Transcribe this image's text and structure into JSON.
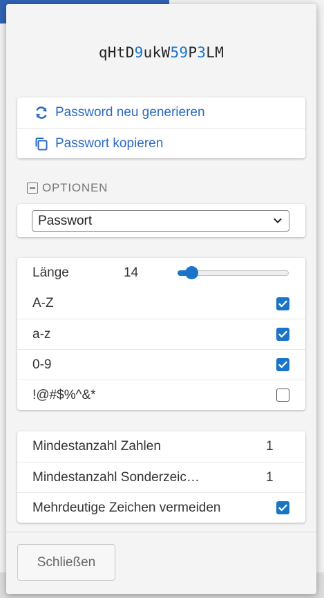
{
  "password": {
    "segments": [
      {
        "text": "qHtD",
        "digit": false
      },
      {
        "text": "9",
        "digit": true
      },
      {
        "text": "ukW",
        "digit": false
      },
      {
        "text": "59",
        "digit": true
      },
      {
        "text": "P",
        "digit": false
      },
      {
        "text": "3",
        "digit": true
      },
      {
        "text": "LM",
        "digit": false
      }
    ]
  },
  "actions": {
    "regenerate_label": "Password neu generieren",
    "regenerate_icon": "refresh-icon",
    "copy_label": "Passwort kopieren",
    "copy_icon": "copy-icon"
  },
  "options": {
    "header": "OPTIONEN",
    "type_selected": "Passwort"
  },
  "settings": {
    "length_label": "Länge",
    "length_value": "14",
    "length_slider_fraction": 0.06,
    "items": [
      {
        "label": "A-Z",
        "checked": true
      },
      {
        "label": "a-z",
        "checked": true
      },
      {
        "label": "0-9",
        "checked": true
      },
      {
        "label": "!@#$%^&*",
        "checked": false
      }
    ]
  },
  "minimums": {
    "min_numbers_label": "Mindestanzahl Zahlen",
    "min_numbers_value": "1",
    "min_special_label": "Mindestanzahl Sonderzeic…",
    "min_special_value": "1",
    "avoid_ambiguous_label": "Mehrdeutige Zeichen vermeiden",
    "avoid_ambiguous_checked": true
  },
  "footer": {
    "close_label": "Schließen"
  },
  "colors": {
    "accent": "#1a74c8",
    "action_text": "#2b6bc7",
    "background_topbar": "#2f62b3"
  }
}
